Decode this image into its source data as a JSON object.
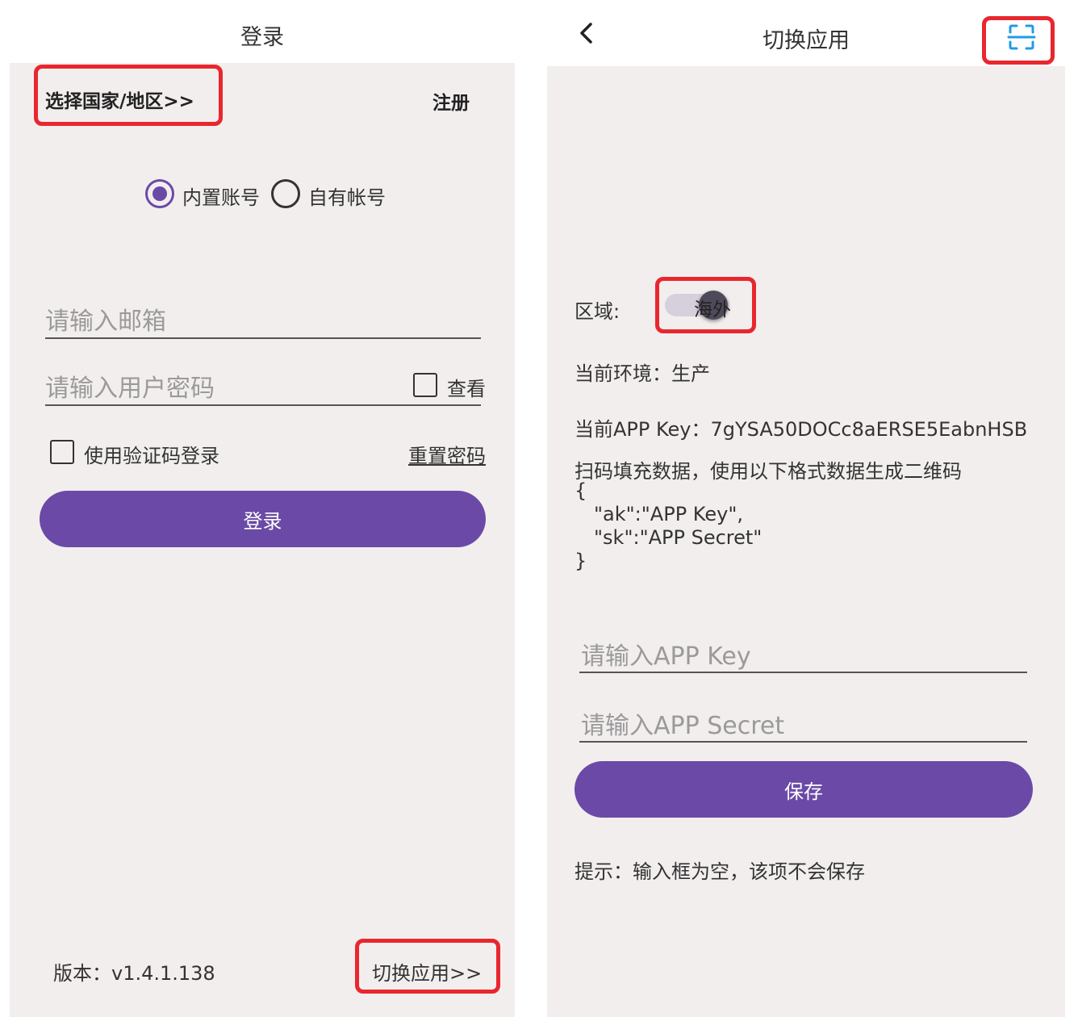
{
  "login": {
    "title": "登录",
    "select_region": "选择国家/地区>>",
    "register": "注册",
    "radio_builtin": "内置账号",
    "radio_own": "自有帐号",
    "email_placeholder": "请输入邮箱",
    "password_placeholder": "请输入用户密码",
    "view_label": "查看",
    "use_code_label": "使用验证码登录",
    "reset_password": "重置密码",
    "login_button": "登录",
    "version": "版本：v1.4.1.138",
    "switch_app": "切换应用>>"
  },
  "switch": {
    "title": "切换应用",
    "back_icon": "chevron-left-icon",
    "scan_icon": "scan-icon",
    "region_label": "区域:",
    "region_value": "海外",
    "env": "当前环境：生产",
    "app_key": "当前APP Key：7gYSA50DOCc8aERSE5EabnHSB",
    "scan_hint": "扫码填充数据，使用以下格式数据生成二维码",
    "json_lines": [
      "{",
      "\"ak\":\"APP Key\",",
      "\"sk\":\"APP Secret\"",
      "}"
    ],
    "app_key_placeholder": "请输入APP Key",
    "app_secret_placeholder": "请输入APP Secret",
    "save_button": "保存",
    "tip": "提示：输入框为空，该项不会保存"
  },
  "colors": {
    "accent": "#6a4aa6",
    "highlight": "#e8272e",
    "scan_icon": "#1e9be8",
    "background": "#f3eeee"
  }
}
